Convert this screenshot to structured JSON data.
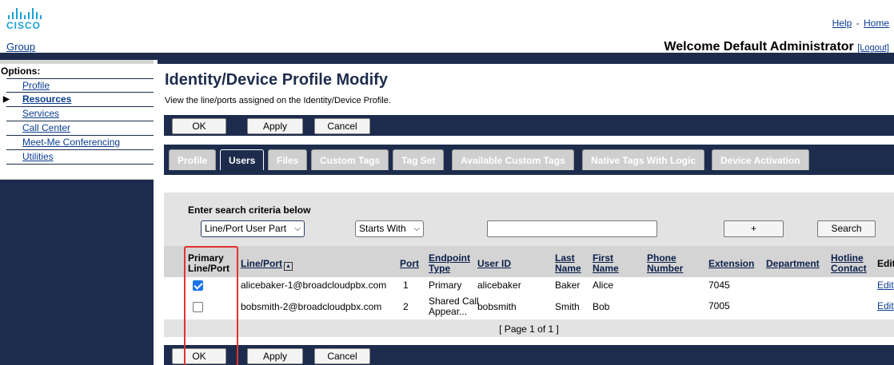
{
  "brand": {
    "logo_text": "CISCO",
    "group_link": "Group"
  },
  "top_links": {
    "help": "Help",
    "separator": "-",
    "home": "Home"
  },
  "welcome": {
    "text": "Welcome Default Administrator",
    "logout": "[Logout]"
  },
  "sidebar": {
    "title": "Options:",
    "items": [
      {
        "label": "Profile",
        "active": false
      },
      {
        "label": "Resources",
        "active": true
      },
      {
        "label": "Services",
        "active": false
      },
      {
        "label": "Call Center",
        "active": false
      },
      {
        "label": "Meet-Me Conferencing",
        "active": false
      },
      {
        "label": "Utilities",
        "active": false
      }
    ]
  },
  "page": {
    "title": "Identity/Device Profile Modify",
    "description": "View the line/ports assigned on the Identity/Device Profile."
  },
  "buttons": {
    "ok": "OK",
    "apply": "Apply",
    "cancel": "Cancel"
  },
  "tabs": [
    {
      "label": "Profile",
      "active": false
    },
    {
      "label": "Users",
      "active": true
    },
    {
      "label": "Files",
      "active": false
    },
    {
      "label": "Custom Tags",
      "active": false
    },
    {
      "label": "Tag Set",
      "active": false
    },
    {
      "label": "Available Custom Tags",
      "active": false
    },
    {
      "label": "Native Tags With Logic",
      "active": false
    },
    {
      "label": "Device Activation",
      "active": false
    }
  ],
  "search": {
    "title": "Enter search criteria below",
    "field_select": "Line/Port User Part",
    "mode_select": "Starts With",
    "value": "",
    "add_label": "+",
    "search_label": "Search"
  },
  "table": {
    "columns": {
      "primary_line_port": [
        "Primary",
        "Line/Port"
      ],
      "line_port": "Line/Port",
      "sort_indicator": "▲",
      "port": "Port",
      "endpoint_type": [
        "Endpoint",
        "Type"
      ],
      "user_id": "User ID",
      "last_name": [
        "Last",
        "Name"
      ],
      "first_name": [
        "First",
        "Name"
      ],
      "phone_number": [
        "Phone",
        "Number"
      ],
      "extension": "Extension",
      "department": "Department",
      "hotline_contact": [
        "Hotline",
        "Contact"
      ],
      "edit": "Edit"
    },
    "rows": [
      {
        "primary": true,
        "line_port": "alicebaker-1@broadcloudpbx.com",
        "port": "1",
        "endpoint_type": [
          "Primary"
        ],
        "user_id": "alicebaker",
        "last_name": "Baker",
        "first_name": "Alice",
        "phone_number": "",
        "extension": "7045",
        "department": "",
        "hotline_contact": "",
        "edit": "Edit"
      },
      {
        "primary": false,
        "line_port": "bobsmith-2@broadcloudpbx.com",
        "port": "2",
        "endpoint_type": [
          "Shared Call",
          "Appear..."
        ],
        "user_id": "bobsmith",
        "last_name": "Smith",
        "first_name": "Bob",
        "phone_number": "",
        "extension": "7005",
        "department": "",
        "hotline_contact": "",
        "edit": "Edit"
      }
    ],
    "pager": "[ Page 1 of 1 ]"
  },
  "colors": {
    "navy": "#1d2c4c",
    "highlight_border": "#e0332f",
    "brand_blue": "#1ba0d7",
    "checkbox_blue": "#1a73e8"
  }
}
